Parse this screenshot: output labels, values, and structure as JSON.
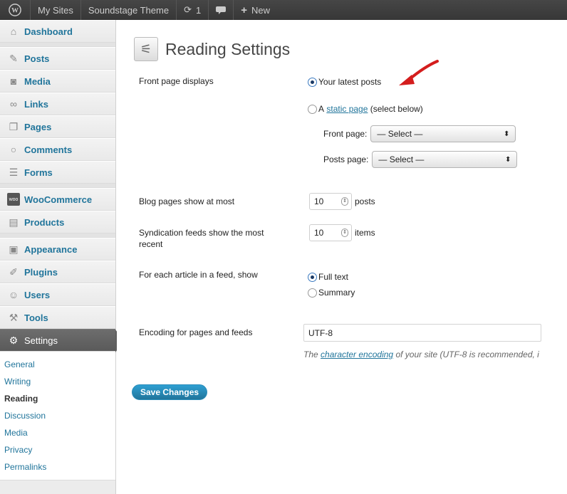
{
  "adminbar": {
    "my_sites": "My Sites",
    "site_name": "Soundstage Theme",
    "updates_count": "1",
    "new_label": "New"
  },
  "sidebar": {
    "items": [
      {
        "label": "Dashboard",
        "icon": "home-icon"
      },
      {
        "label": "Posts",
        "icon": "pushpin-icon"
      },
      {
        "label": "Media",
        "icon": "camera-icon"
      },
      {
        "label": "Links",
        "icon": "link-icon"
      },
      {
        "label": "Pages",
        "icon": "pages-icon"
      },
      {
        "label": "Comments",
        "icon": "speech-bubble-icon"
      },
      {
        "label": "Forms",
        "icon": "form-icon"
      },
      {
        "label": "WooCommerce",
        "icon": "woocommerce-icon",
        "icon_text": "woo"
      },
      {
        "label": "Products",
        "icon": "cart-icon"
      },
      {
        "label": "Appearance",
        "icon": "appearance-icon"
      },
      {
        "label": "Plugins",
        "icon": "plug-icon"
      },
      {
        "label": "Users",
        "icon": "users-icon"
      },
      {
        "label": "Tools",
        "icon": "tools-icon"
      },
      {
        "label": "Settings",
        "icon": "settings-icon"
      }
    ],
    "submenu": [
      "General",
      "Writing",
      "Reading",
      "Discussion",
      "Media",
      "Privacy",
      "Permalinks"
    ]
  },
  "page": {
    "title": "Reading Settings",
    "front_page_label": "Front page displays",
    "latest_posts_label": "Your latest posts",
    "static_prefix": "A",
    "static_link": "static page",
    "static_suffix": "(select below)",
    "front_page_select_label": "Front page:",
    "posts_page_select_label": "Posts page:",
    "select_placeholder": "— Select —",
    "blog_pages_label": "Blog pages show at most",
    "blog_pages_value": "10",
    "blog_pages_unit": "posts",
    "feeds_label": "Syndication feeds show the most recent",
    "feeds_value": "10",
    "feeds_unit": "items",
    "article_feed_label": "For each article in a feed, show",
    "full_text_label": "Full text",
    "summary_label": "Summary",
    "encoding_label": "Encoding for pages and feeds",
    "encoding_value": "UTF-8",
    "encoding_desc_prefix": "The",
    "encoding_desc_link": "character encoding",
    "encoding_desc_suffix": "of your site (UTF-8 is recommended, i",
    "save_button": "Save Changes"
  },
  "colors": {
    "accent": "#21759b",
    "annotation_arrow": "#d41d1d"
  }
}
